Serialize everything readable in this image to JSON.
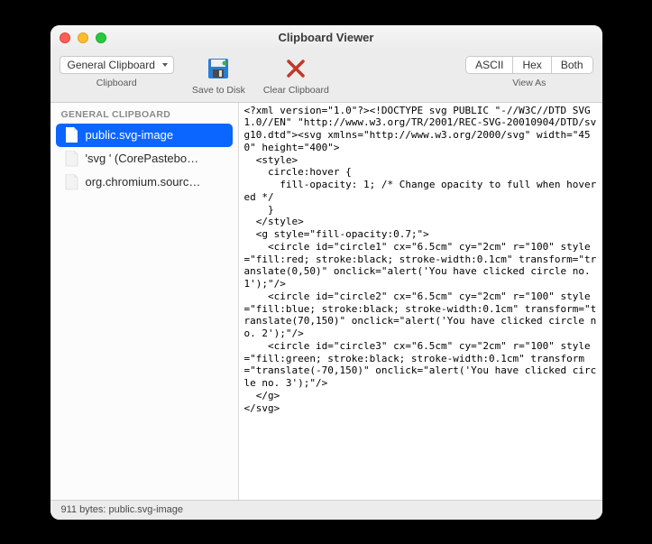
{
  "window": {
    "title": "Clipboard Viewer"
  },
  "toolbar": {
    "clipboard_selector": "General Clipboard",
    "clipboard_label": "Clipboard",
    "save_label": "Save to Disk",
    "clear_label": "Clear Clipboard",
    "view_as_label": "View As",
    "seg": {
      "ascii": "ASCII",
      "hex": "Hex",
      "both": "Both"
    }
  },
  "sidebar": {
    "section": "GENERAL CLIPBOARD",
    "items": [
      {
        "label": "public.svg-image",
        "selected": true
      },
      {
        "label": "'svg ' (CorePastebo…",
        "selected": false
      },
      {
        "label": "org.chromium.sourc…",
        "selected": false
      }
    ]
  },
  "content_text": "<?xml version=\"1.0\"?><!DOCTYPE svg PUBLIC \"-//W3C//DTD SVG 1.0//EN\" \"http://www.w3.org/TR/2001/REC-SVG-20010904/DTD/svg10.dtd\"><svg xmlns=\"http://www.w3.org/2000/svg\" width=\"450\" height=\"400\">\n  <style>\n    circle:hover {\n      fill-opacity: 1; /* Change opacity to full when hovered */\n    }\n  </style>\n  <g style=\"fill-opacity:0.7;\">\n    <circle id=\"circle1\" cx=\"6.5cm\" cy=\"2cm\" r=\"100\" style=\"fill:red; stroke:black; stroke-width:0.1cm\" transform=\"translate(0,50)\" onclick=\"alert('You have clicked circle no. 1');\"/>\n    <circle id=\"circle2\" cx=\"6.5cm\" cy=\"2cm\" r=\"100\" style=\"fill:blue; stroke:black; stroke-width:0.1cm\" transform=\"translate(70,150)\" onclick=\"alert('You have clicked circle no. 2');\"/>\n    <circle id=\"circle3\" cx=\"6.5cm\" cy=\"2cm\" r=\"100\" style=\"fill:green; stroke:black; stroke-width:0.1cm\" transform=\"translate(-70,150)\" onclick=\"alert('You have clicked circle no. 3');\"/>\n  </g>\n</svg>",
  "status": "911 bytes: public.svg-image"
}
